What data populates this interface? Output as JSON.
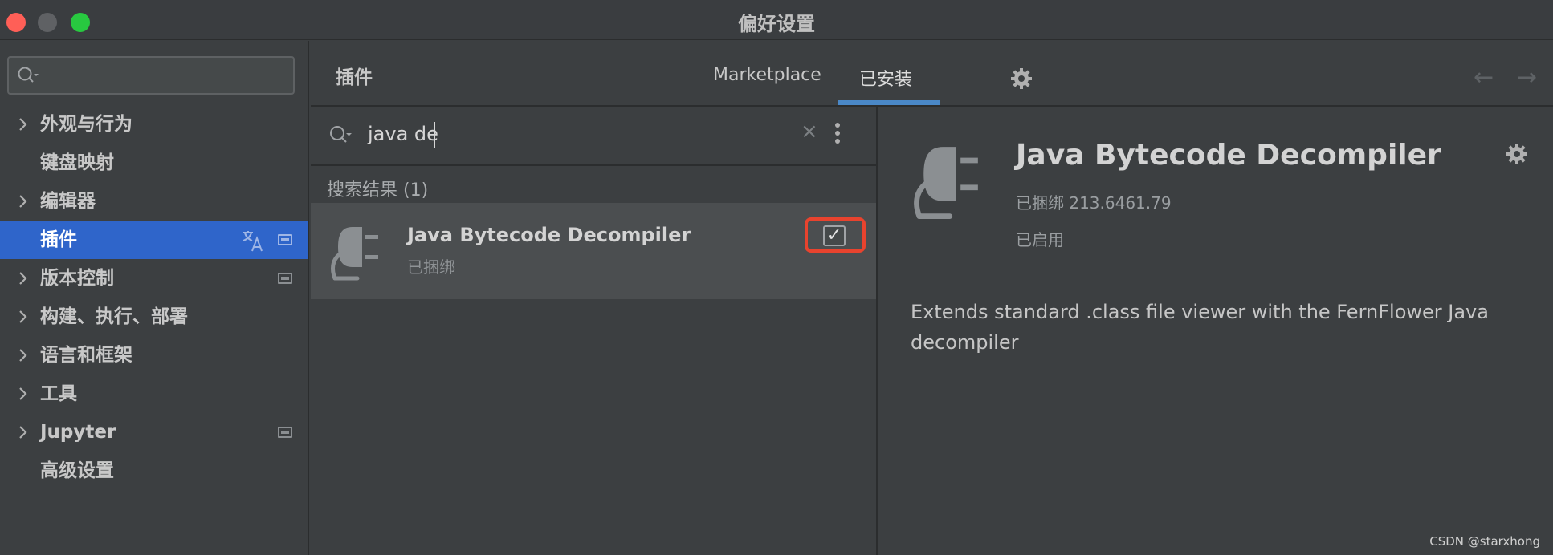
{
  "window": {
    "title": "偏好设置"
  },
  "sidebar": {
    "search_placeholder": "",
    "items": [
      {
        "label": "外观与行为",
        "expandable": true
      },
      {
        "label": "键盘映射",
        "expandable": false
      },
      {
        "label": "编辑器",
        "expandable": true
      },
      {
        "label": "插件",
        "expandable": false,
        "active": true
      },
      {
        "label": "版本控制",
        "expandable": true
      },
      {
        "label": "构建、执行、部署",
        "expandable": true
      },
      {
        "label": "语言和框架",
        "expandable": true
      },
      {
        "label": "工具",
        "expandable": true
      },
      {
        "label": "Jupyter",
        "expandable": true
      },
      {
        "label": "高级设置",
        "expandable": false
      }
    ]
  },
  "header": {
    "title": "插件",
    "tabs": [
      {
        "label": "Marketplace",
        "active": false
      },
      {
        "label": "已安装",
        "active": true
      }
    ]
  },
  "plugin_list": {
    "search_value": "java de",
    "results_heading": "搜索结果 (1)",
    "results": [
      {
        "name": "Java Bytecode Decompiler",
        "subtitle": "已捆绑",
        "enabled": true,
        "check_glyph": "✓"
      }
    ]
  },
  "detail": {
    "name": "Java Bytecode Decompiler",
    "version": "已捆绑 213.6461.79",
    "status": "已启用",
    "description": "Extends standard .class file viewer with the FernFlower Java decompiler"
  },
  "icons": {
    "close_search": "×",
    "back_arrow": "←",
    "forward_arrow": "→"
  },
  "watermark": "CSDN @starxhong",
  "colors": {
    "accent": "#2f65ca",
    "tab_underline": "#4a88c7",
    "highlight": "#e8432e"
  }
}
